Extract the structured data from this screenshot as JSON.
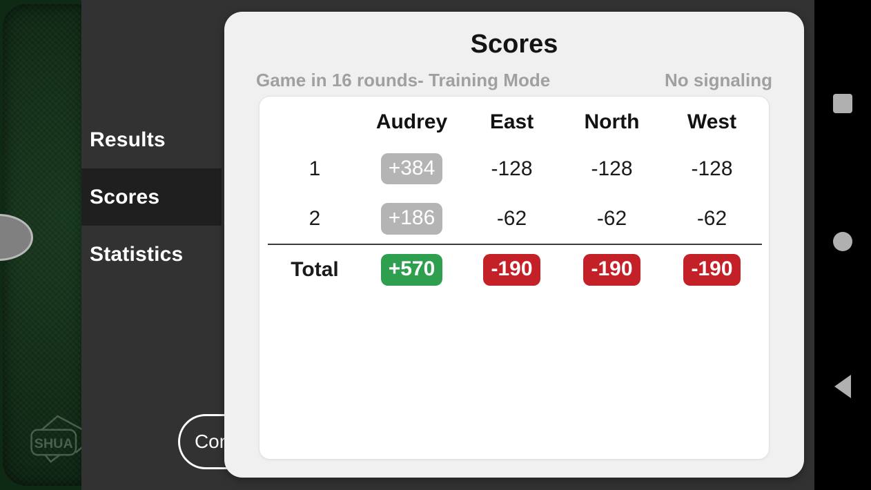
{
  "app": {
    "background_color": "#323232",
    "table_felt_color": "#112d16",
    "table_logo_text": "SHUA"
  },
  "side_nav": {
    "items": [
      {
        "label": "Results",
        "active": false
      },
      {
        "label": "Scores",
        "active": true
      },
      {
        "label": "Statistics",
        "active": false
      }
    ]
  },
  "continue_button": {
    "label": "Continue"
  },
  "modal": {
    "title": "Scores",
    "subtitle_left": "Game in 16 rounds- Training Mode",
    "subtitle_right": "No signaling"
  },
  "scores_table": {
    "index_header": "",
    "columns": [
      "Audrey",
      "East",
      "North",
      "West"
    ],
    "rows": [
      {
        "index": "1",
        "cells": [
          {
            "value": "+384",
            "style": "neutral"
          },
          {
            "value": "-128",
            "style": "plain"
          },
          {
            "value": "-128",
            "style": "plain"
          },
          {
            "value": "-128",
            "style": "plain"
          }
        ]
      },
      {
        "index": "2",
        "cells": [
          {
            "value": "+186",
            "style": "neutral"
          },
          {
            "value": "-62",
            "style": "plain"
          },
          {
            "value": "-62",
            "style": "plain"
          },
          {
            "value": "-62",
            "style": "plain"
          }
        ]
      }
    ],
    "total": {
      "label": "Total",
      "cells": [
        {
          "value": "+570",
          "style": "positive"
        },
        {
          "value": "-190",
          "style": "negative"
        },
        {
          "value": "-190",
          "style": "negative"
        },
        {
          "value": "-190",
          "style": "negative"
        }
      ]
    }
  },
  "colors": {
    "positive_badge": "#2e9e4f",
    "negative_badge": "#c32127",
    "neutral_badge": "#b4b4b4",
    "modal_background": "#f0f0f0",
    "card_background": "#ffffff",
    "subtitle_text": "#a0a0a0"
  },
  "android_navbar": {
    "buttons": [
      {
        "name": "recents",
        "glyph": "square-icon"
      },
      {
        "name": "home",
        "glyph": "circle-icon"
      },
      {
        "name": "back",
        "glyph": "triangle-left-icon"
      }
    ]
  }
}
